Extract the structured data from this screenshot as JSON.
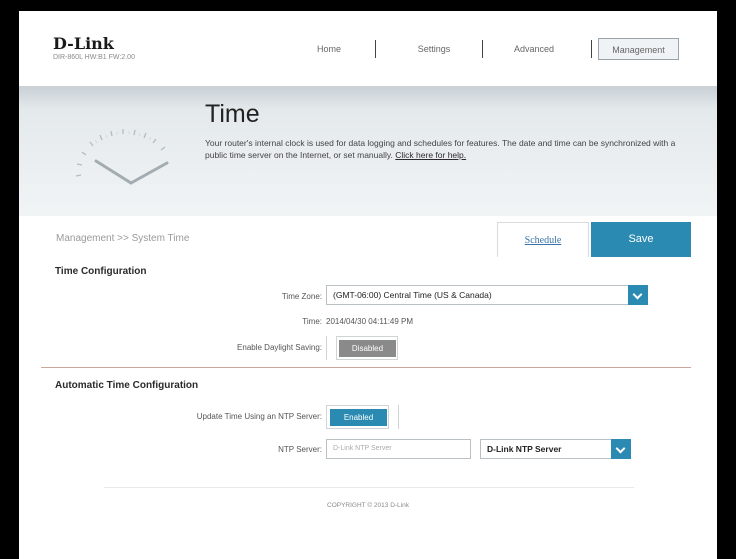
{
  "brand": {
    "logo": "D-Link",
    "model": "DIR-860L   HW:B1   FW:2.00"
  },
  "nav": {
    "items": [
      "Home",
      "Settings",
      "Advanced",
      "Management"
    ],
    "active": "Management"
  },
  "banner": {
    "title": "Time",
    "description": "Your router's internal clock is used for data logging and schedules for features. The date and time can be synchronized with a public time server on the Internet, or set manually.",
    "help_link": "Click here for help."
  },
  "toolbar": {
    "breadcrumb": "Management >> System Time",
    "schedule_tab": "Schedule",
    "save_label": "Save"
  },
  "time_config": {
    "title": "Time Configuration",
    "time_zone_label": "Time Zone:",
    "time_zone_value": "(GMT-06:00) Central Time (US & Canada)",
    "time_label": "Time:",
    "time_value": "2014/04/30 04:11:49 PM",
    "daylight_label": "Enable Daylight Saving:",
    "daylight_state": "Disabled"
  },
  "auto_time": {
    "title": "Automatic Time Configuration",
    "ntp_update_label": "Update Time Using an NTP Server:",
    "ntp_update_state": "Enabled",
    "ntp_server_label": "NTP Server:",
    "ntp_server_placeholder": "D-Link NTP Server",
    "ntp_server_select": "D-Link NTP Server"
  },
  "footer": {
    "copyright": "COPYRIGHT © 2013 D-Link"
  },
  "colors": {
    "accent": "#2a8ab2",
    "toggle_disabled": "#888888",
    "divider": "#c9a79a"
  }
}
